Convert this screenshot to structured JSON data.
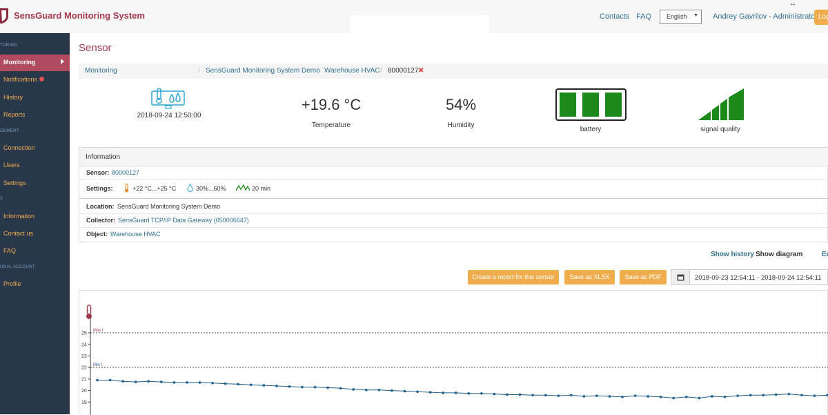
{
  "header": {
    "brand": "SensGuard Monitoring System",
    "contacts": "Contacts",
    "faq": "FAQ",
    "language": "English",
    "user": "Andrey Gavrilov - Administrator",
    "logout": "Log",
    "resize_icon": "↔"
  },
  "sidebar": {
    "sections": [
      "TORING",
      "GEMENT",
      "S",
      "ONAL ACCOUNT"
    ],
    "items": [
      "Monitoring",
      "Notifications",
      "History",
      "Reports",
      "Connection",
      "Users",
      "Settings",
      "Information",
      "Contact us",
      "FAQ",
      "Profile"
    ]
  },
  "page": {
    "title": "Sensor",
    "breadcrumb": [
      "Monitoring",
      "SensGuard Monitoring System Demo",
      "Warehouse HVAC",
      "80000127"
    ],
    "breadcrumb_close": "✖"
  },
  "summary": {
    "timestamp": "2018-09-24 12:50:00",
    "temperature": "+19.6 °C",
    "temperature_label": "Temperature",
    "humidity": "54%",
    "humidity_label": "Humidity",
    "battery_label": "battery",
    "battery_level": 3,
    "battery_max": 3,
    "signal_label": "signal quality",
    "signal_level": 4,
    "signal_max": 4
  },
  "info": {
    "title": "Information",
    "sensor_label": "Sensor:",
    "sensor_value": "80000127",
    "settings_label": "Settings:",
    "temp_range": "+22 °C...+25 °C",
    "humidity_range": "30%...60%",
    "interval": "20 min",
    "location_label": "Location:",
    "location_value": "SensGuard Monitoring System Demo",
    "collector_label": "Collector:",
    "collector_value": "SensGuard TCP/IP Data Gateway (050006647)",
    "object_label": "Object:",
    "object_value": "Warehouse HVAC"
  },
  "actions": {
    "show_history": "Show history",
    "show_diagram": "Show diagram",
    "edit": "Ed",
    "report": "Create a report for this sensor",
    "xlsx": "Save as XLSX",
    "pdf": "Save as PDF",
    "date_range": "2018-09-23 12:54:11 - 2018-09-24 12:54:11"
  },
  "chart_data": {
    "type": "line",
    "title": "",
    "xlabel": "",
    "ylabel": "",
    "ylim": [
      18.6,
      25.9
    ],
    "yticks": [
      19,
      20,
      21,
      22,
      23,
      24,
      25
    ],
    "max_label": "Max t",
    "max_value": 25,
    "min_label": "Min t",
    "min_value": 22,
    "series": [
      {
        "values": [
          20.9,
          20.9,
          20.8,
          20.75,
          20.8,
          20.75,
          20.7,
          20.7,
          20.7,
          20.65,
          20.6,
          20.55,
          20.5,
          20.45,
          20.4,
          20.35,
          20.3,
          20.3,
          20.25,
          20.2,
          20.1,
          20.05,
          20.05,
          20.0,
          19.95,
          19.9,
          19.85,
          19.8,
          19.8,
          19.75,
          19.75,
          19.7,
          19.65,
          19.65,
          19.6,
          19.6,
          19.55,
          19.6,
          19.5,
          19.55,
          19.5,
          19.45,
          19.55,
          19.5,
          19.45,
          19.35,
          19.45,
          19.35,
          19.5,
          19.45,
          19.55,
          19.6,
          19.6,
          19.65,
          19.7,
          19.6,
          19.55,
          19.6
        ]
      }
    ]
  },
  "colors": {
    "brand": "#a63a4e",
    "sidebar": "#28374a",
    "accent": "#f0ad4e",
    "link": "#31708f",
    "ok": "#1b8a1b",
    "series": "#1f5f8b"
  }
}
